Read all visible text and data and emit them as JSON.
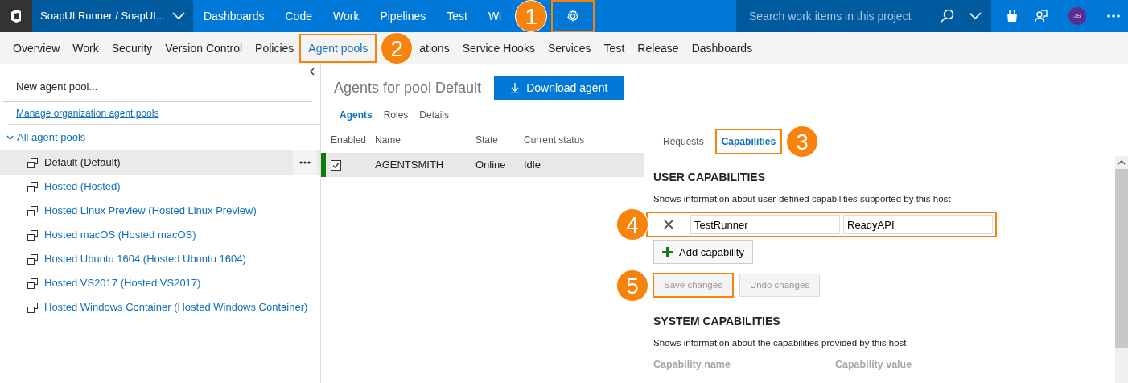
{
  "top_bar": {
    "project": "SoapUI Runner / SoapUI...",
    "nav": [
      {
        "label": "Dashboards"
      },
      {
        "label": "Code"
      },
      {
        "label": "Work"
      },
      {
        "label": "Pipelines"
      },
      {
        "label": "Test"
      },
      {
        "label": "Wi"
      }
    ],
    "settings": {
      "highlighted": true,
      "callout": "1"
    },
    "search": {
      "placeholder": "Search work items in this project"
    },
    "avatar": "JS"
  },
  "admin_tabs": [
    {
      "label": "Overview",
      "selected": false
    },
    {
      "label": "Work",
      "selected": false
    },
    {
      "label": "Security",
      "selected": false
    },
    {
      "label": "Version Control",
      "selected": false
    },
    {
      "label": "Policies",
      "selected": false
    },
    {
      "label": "Agent pools",
      "selected": true,
      "highlighted": true,
      "callout": "2"
    },
    {
      "label": "ations",
      "selected": false
    },
    {
      "label": "Service Hooks",
      "selected": false
    },
    {
      "label": "Services",
      "selected": false
    },
    {
      "label": "Test",
      "selected": false
    },
    {
      "label": "Release",
      "selected": false
    },
    {
      "label": "Dashboards",
      "selected": false
    }
  ],
  "sidebar": {
    "new_pool": "New agent pool...",
    "manage_link": "Manage organization agent pools",
    "tree": {
      "label": "All agent pools",
      "expanded": true,
      "children": [
        {
          "label": "Default (Default)",
          "selected": true
        },
        {
          "label": "Hosted (Hosted)",
          "selected": false
        },
        {
          "label": "Hosted Linux Preview (Hosted Linux Preview)",
          "selected": false
        },
        {
          "label": "Hosted macOS (Hosted macOS)",
          "selected": false
        },
        {
          "label": "Hosted Ubuntu 1604 (Hosted Ubuntu 1604)",
          "selected": false
        },
        {
          "label": "Hosted VS2017 (Hosted VS2017)",
          "selected": false
        },
        {
          "label": "Hosted Windows Container (Hosted Windows Container)",
          "selected": false
        }
      ]
    }
  },
  "agents": {
    "title": "Agents for pool Default",
    "download": "Download agent",
    "tabs": [
      {
        "label": "Agents",
        "selected": true
      },
      {
        "label": "Roles",
        "selected": false
      },
      {
        "label": "Details",
        "selected": false
      }
    ],
    "columns": [
      "Enabled",
      "Name",
      "State",
      "Current status"
    ],
    "rows": [
      {
        "enabled": true,
        "name": "AGENTSMITH",
        "state": "Online",
        "status": "Idle",
        "selected": true
      }
    ]
  },
  "details": {
    "tabs": [
      {
        "label": "Requests",
        "selected": false
      },
      {
        "label": "Capabilities",
        "selected": true,
        "highlighted": true,
        "callout": "3"
      }
    ],
    "user_capabilities": {
      "title": "USER CAPABILITIES",
      "description": "Shows information about user-defined capabilities supported by this host",
      "rows": [
        {
          "name": "TestRunner",
          "value": "ReadyAPI",
          "highlighted": true,
          "callout": "4"
        }
      ],
      "add_button": "Add capability",
      "save_button": {
        "label": "Save changes",
        "disabled": true,
        "highlighted": true,
        "callout": "5"
      },
      "undo_button": {
        "label": "Undo changes",
        "disabled": true
      }
    },
    "system_capabilities": {
      "title": "SYSTEM CAPABILITIES",
      "description": "Shows information about the capabilities provided by this host",
      "columns": [
        "Capability name",
        "Capability value"
      ]
    }
  }
}
